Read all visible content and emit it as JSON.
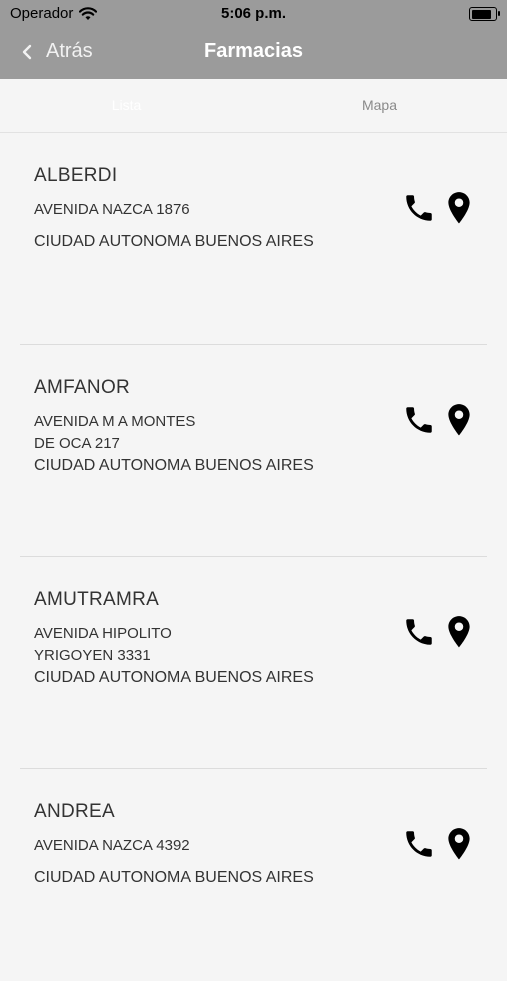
{
  "status_bar": {
    "carrier": "Operador",
    "time": "5:06 p.m.",
    "battery_level": 0.95
  },
  "nav": {
    "back_label": "Atrás",
    "title": "Farmacias"
  },
  "tabs": [
    {
      "label": "Lista",
      "active": true
    },
    {
      "label": "Mapa",
      "active": false
    }
  ],
  "pharmacies": [
    {
      "name": "ALBERDI",
      "address": [
        "AVENIDA NAZCA 1876"
      ],
      "city": "CIUDAD AUTONOMA BUENOS AIRES"
    },
    {
      "name": "AMFANOR",
      "address": [
        "AVENIDA M A MONTES",
        "DE OCA 217"
      ],
      "city": "CIUDAD AUTONOMA BUENOS AIRES"
    },
    {
      "name": "AMUTRAMRA",
      "address": [
        "AVENIDA HIPOLITO",
        "YRIGOYEN 3331"
      ],
      "city": "CIUDAD AUTONOMA BUENOS AIRES"
    },
    {
      "name": "ANDREA",
      "address": [
        "AVENIDA NAZCA 4392"
      ],
      "city": "CIUDAD AUTONOMA BUENOS AIRES"
    }
  ],
  "icons": {
    "phone": "phone-icon",
    "location": "location-pin-icon"
  }
}
